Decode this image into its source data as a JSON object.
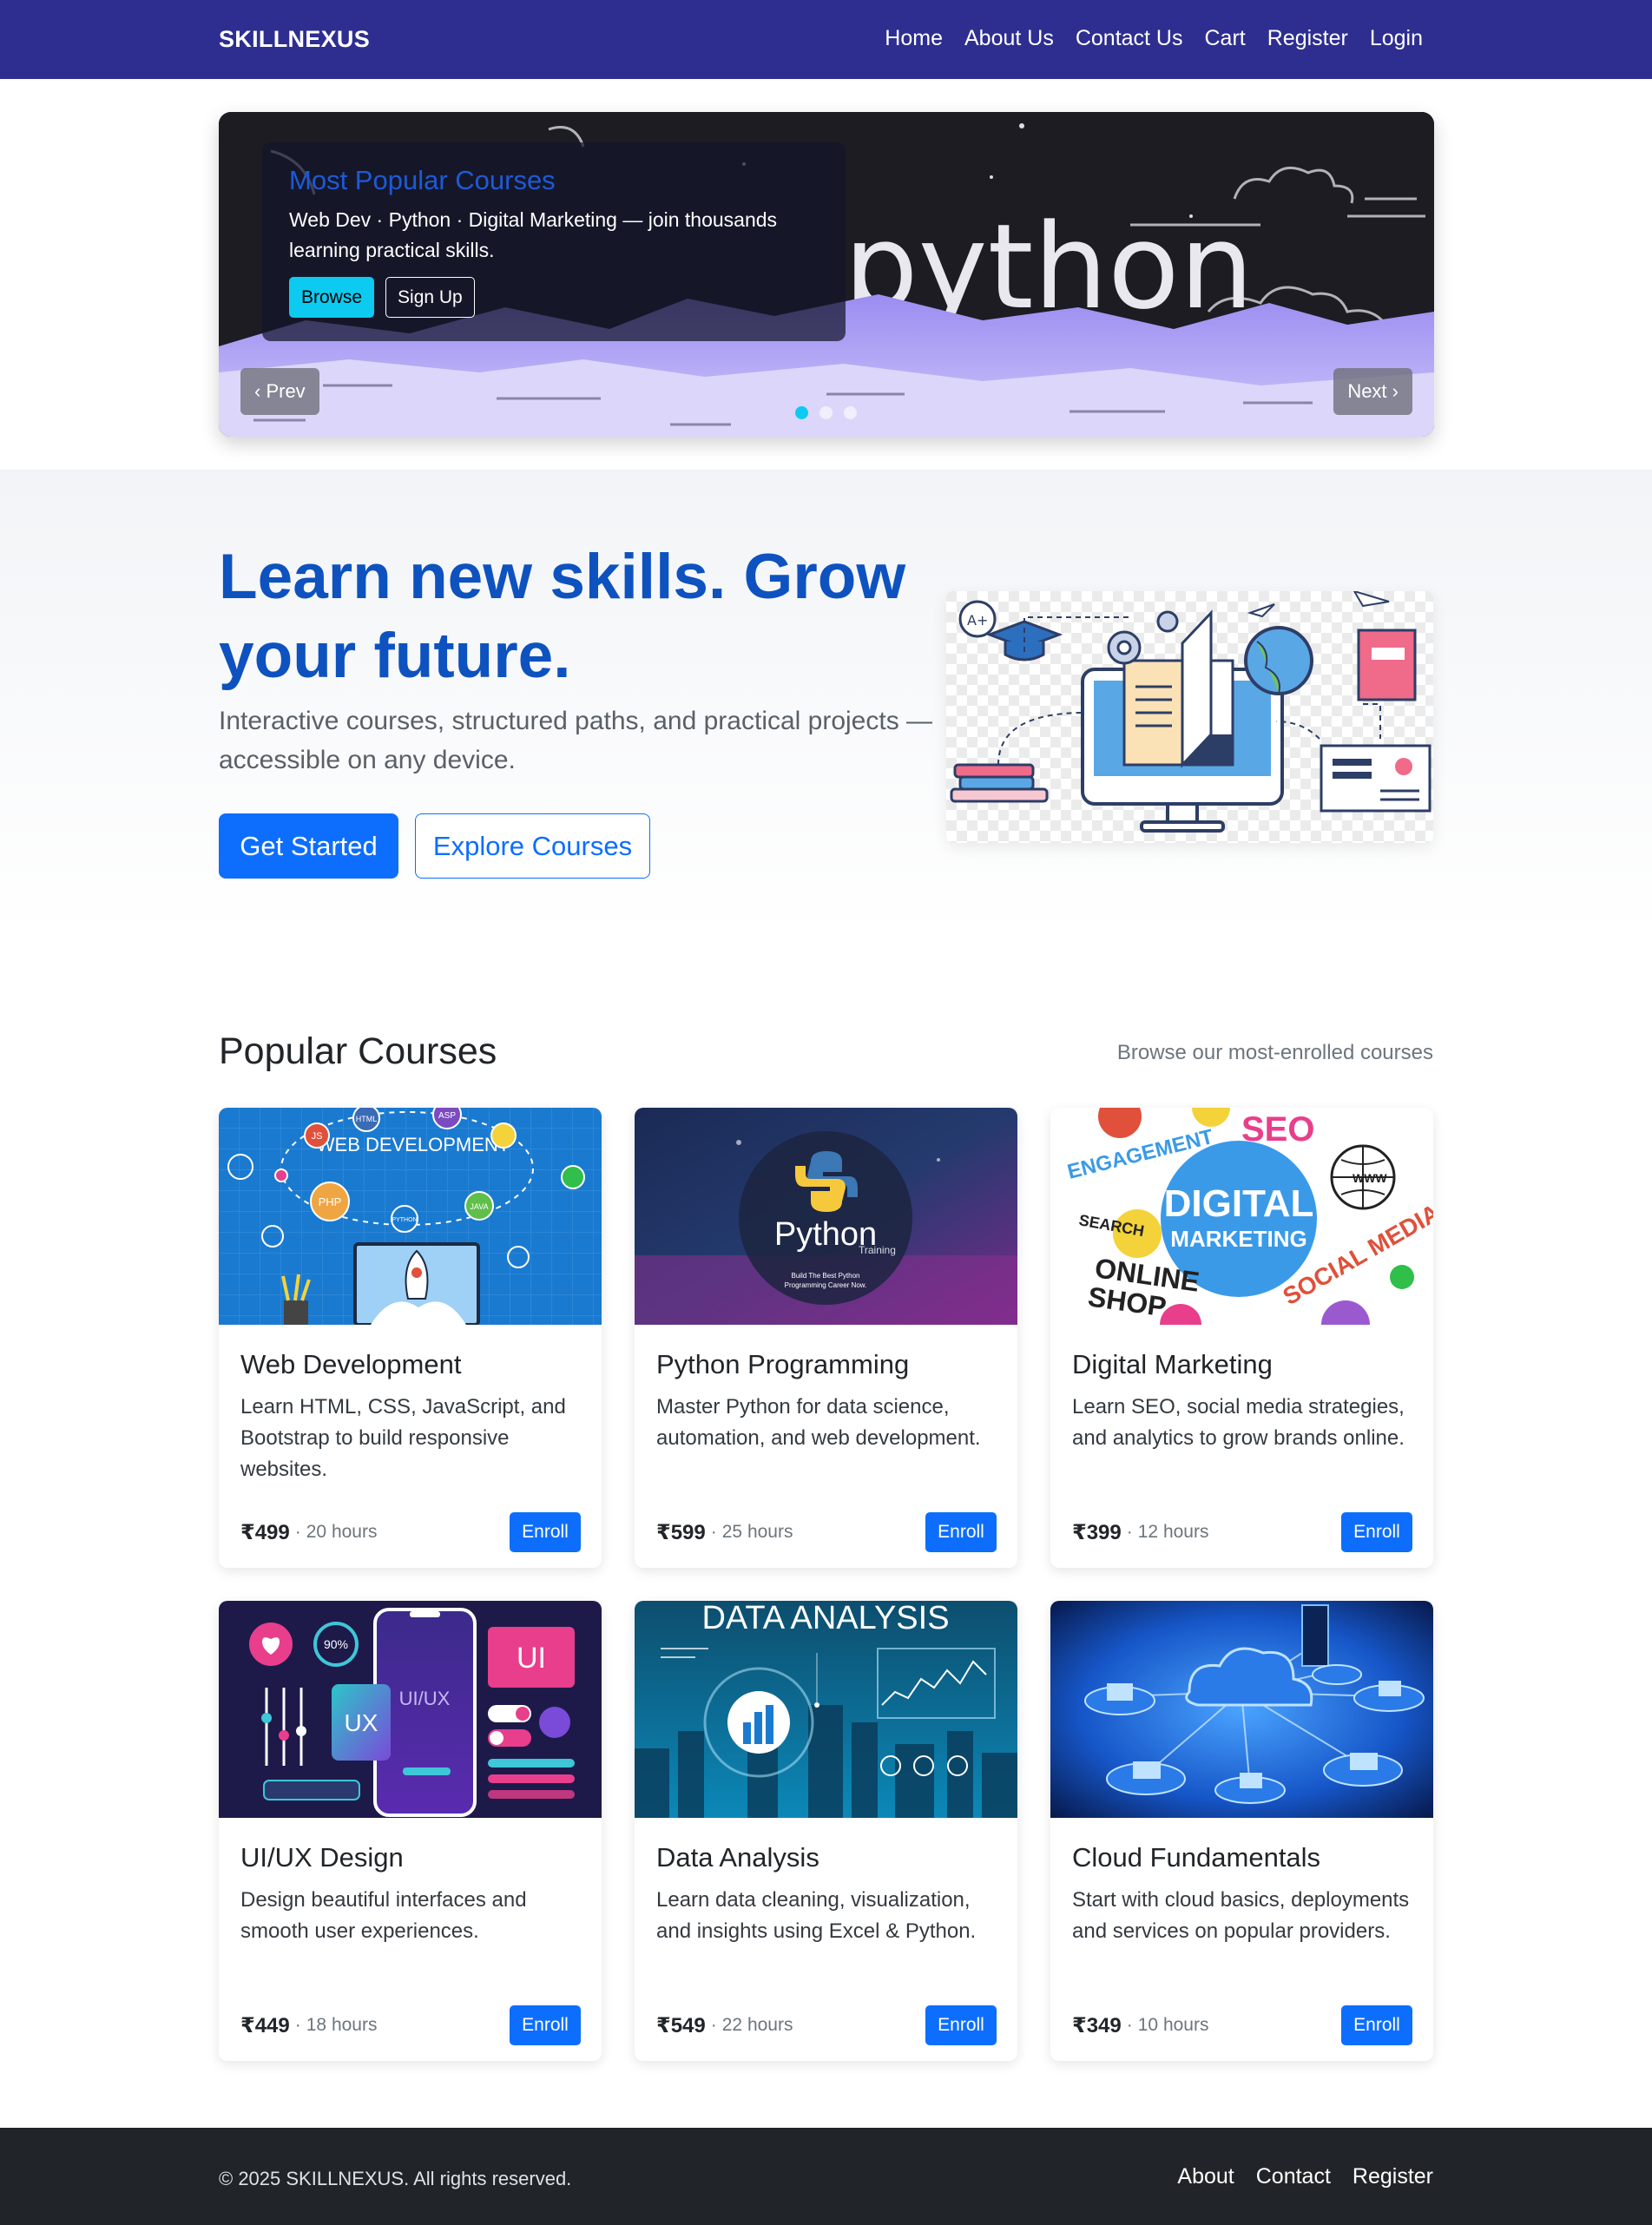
{
  "brand": "SKILLNEXUS",
  "nav": [
    "Home",
    "About Us",
    "Contact Us",
    "Cart",
    "Register",
    "Login"
  ],
  "carousel": {
    "image_text": "python",
    "caption_title": "Most Popular Courses",
    "caption_text": "Web Dev · Python · Digital Marketing — join thousands learning practical skills.",
    "browse_label": "Browse",
    "signup_label": "Sign Up",
    "prev_label": "‹ Prev",
    "next_label": "Next ›",
    "active_slide": 1,
    "slide_count": 3
  },
  "hero": {
    "title": "Learn new skills. Grow your future.",
    "lead": "Interactive courses, structured paths, and practical projects — accessible on any device.",
    "primary_label": "Get Started",
    "secondary_label": "Explore Courses",
    "image_badge": "A+"
  },
  "courses_section": {
    "title": "Popular Courses",
    "subtitle": "Browse our most-enrolled courses"
  },
  "courses": [
    {
      "title": "Web Development",
      "desc": "Learn HTML, CSS, JavaScript, and Bootstrap to build responsive websites.",
      "price": "₹499",
      "hours": "20 hours",
      "enroll": "Enroll",
      "thumb_title": "WEB DEVELOPMENT",
      "thumb_labels": [
        "HTML",
        "ASP",
        "JS",
        "PHP",
        "JAVA",
        "PYTHON"
      ]
    },
    {
      "title": "Python Programming",
      "desc": "Master Python for data science, automation, and web development.",
      "price": "₹599",
      "hours": "25 hours",
      "enroll": "Enroll",
      "thumb_title": "Python",
      "thumb_sub": "Training",
      "thumb_tag": "Build The Best Python Programming Career Now."
    },
    {
      "title": "Digital Marketing",
      "desc": "Learn SEO, social media strategies, and analytics to grow brands online.",
      "price": "₹399",
      "hours": "12 hours",
      "enroll": "Enroll",
      "thumb_title": "DIGITAL",
      "thumb_sub": "MARKETING",
      "thumb_labels": [
        "SEO",
        "ENGAGEMENT",
        "SEARCH",
        "ONLINE",
        "SHOP",
        "SOCIAL MEDIA",
        "WWW"
      ]
    },
    {
      "title": "UI/UX Design",
      "desc": "Design beautiful interfaces and smooth user experiences.",
      "price": "₹449",
      "hours": "18 hours",
      "enroll": "Enroll",
      "thumb_labels": [
        "UI/UX",
        "UX",
        "UI",
        "90%"
      ]
    },
    {
      "title": "Data Analysis",
      "desc": "Learn data cleaning, visualization, and insights using Excel & Python.",
      "price": "₹549",
      "hours": "22 hours",
      "enroll": "Enroll",
      "thumb_title": "DATA ANALYSIS"
    },
    {
      "title": "Cloud Fundamentals",
      "desc": "Start with cloud basics, deployments and services on popular providers.",
      "price": "₹349",
      "hours": "10 hours",
      "enroll": "Enroll"
    }
  ],
  "footer": {
    "copyright": "© 2025 SKILLNEXUS. All rights reserved.",
    "links": [
      "About",
      "Contact",
      "Register"
    ]
  },
  "colors": {
    "nav_bg": "#2e2e91",
    "primary": "#0d6efd",
    "hero_title": "#0d52bf",
    "info": "#0dcaf0",
    "footer_bg": "#212529"
  }
}
